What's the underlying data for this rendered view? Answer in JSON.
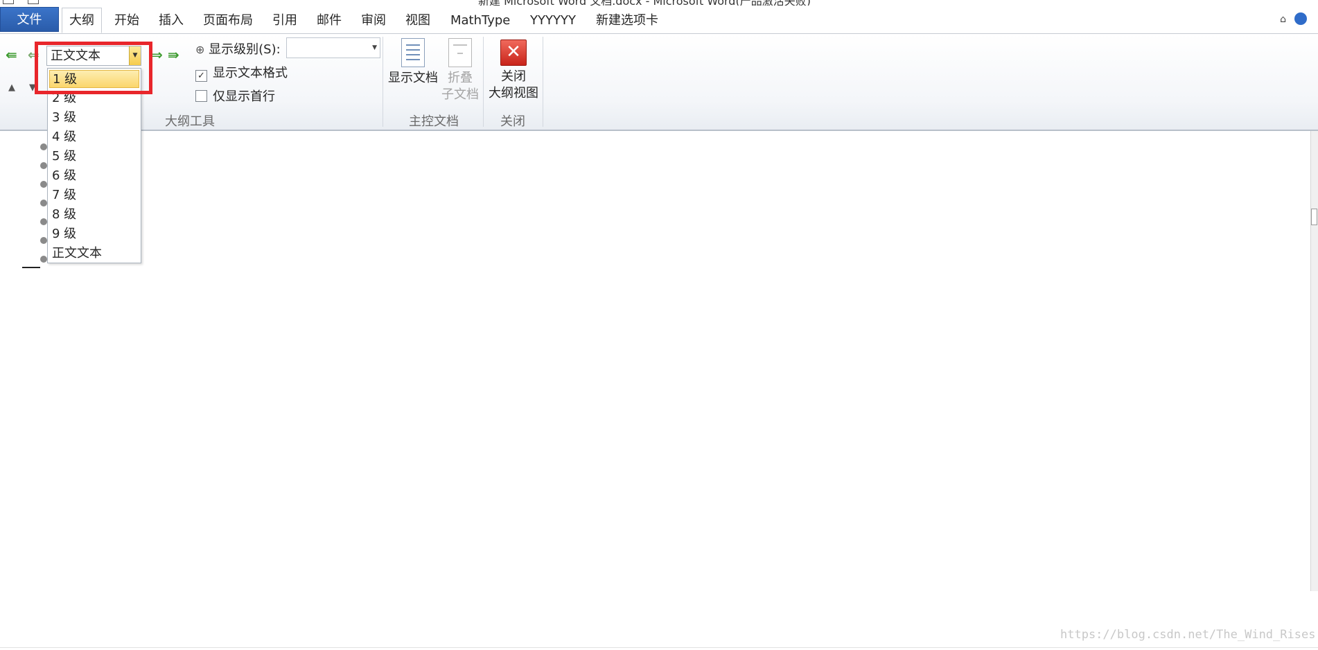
{
  "titlebar": {
    "title": "新建 Microsoft Word 文档.docx - Microsoft Word(产品激活失败)"
  },
  "tabs": {
    "file": "文件",
    "items": [
      "大纲",
      "开始",
      "插入",
      "页面布局",
      "引用",
      "邮件",
      "审阅",
      "视图",
      "MathType",
      "YYYYYY",
      "新建选项卡"
    ],
    "active": "大纲"
  },
  "ribbon": {
    "outline_tools": {
      "level_combo_value": "正文文本",
      "show_level_label": "显示级别(S):",
      "show_level_value": "",
      "show_text_format": {
        "label": "显示文本格式",
        "checked": "✓"
      },
      "show_first_line": {
        "label": "仅显示首行",
        "checked": ""
      },
      "group_label": "大纲工具"
    },
    "master_document": {
      "show_document": "显示文档",
      "collapse_line1": "折叠",
      "collapse_line2": "子文档",
      "group_label": "主控文档"
    },
    "close": {
      "line1": "关闭",
      "line2": "大纲视图",
      "group_label": "关闭"
    }
  },
  "dropdown": {
    "items": [
      "1 级",
      "2 级",
      "3 级",
      "4 级",
      "5 级",
      "6 级",
      "7 级",
      "8 级",
      "9 级",
      "正文文本"
    ],
    "selected_index": 0
  },
  "watermark": "https://blog.csdn.net/The_Wind_Rises",
  "colors": {
    "file_tab": "#2a5caa",
    "highlight": "#e8262b",
    "selected_item": "#fbd66c",
    "promote_arrows": "#3c9a2e"
  }
}
